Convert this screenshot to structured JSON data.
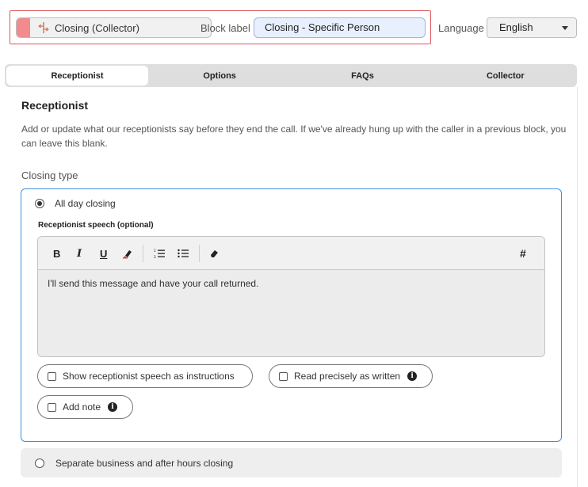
{
  "header": {
    "block_name": "Closing (Collector)",
    "block_color": "#f28b8e",
    "block_icon": "closing-icon",
    "block_label_caption": "Block label",
    "block_label_value": "Closing - Specific Person",
    "language_caption": "Language",
    "language_value": "English"
  },
  "tabs": [
    {
      "label": "Receptionist",
      "active": true
    },
    {
      "label": "Options",
      "active": false
    },
    {
      "label": "FAQs",
      "active": false
    },
    {
      "label": "Collector",
      "active": false
    }
  ],
  "section": {
    "title": "Receptionist",
    "description": "Add or update what our receptionists say before they end the call. If we've already hung up with the caller in a previous block, you can leave this blank.",
    "closing_type_label": "Closing type",
    "options": [
      {
        "label": "All day closing",
        "selected": true
      },
      {
        "label": "Separate business and after hours closing",
        "selected": false
      }
    ],
    "speech_label": "Receptionist speech (optional)",
    "speech_text": "I'll send this message and have your call returned.",
    "toolbar": {
      "bold": "B",
      "italic": "I",
      "underline": "U",
      "variable": "#"
    },
    "checkboxes": [
      {
        "label": "Show receptionist speech as instructions",
        "checked": false
      },
      {
        "label": "Read precisely as written",
        "checked": false,
        "info": true
      },
      {
        "label": "Add note",
        "checked": false,
        "info": true
      }
    ],
    "info_glyph": "i"
  },
  "colors": {
    "accent_border": "#3d8fe0",
    "highlight_frame": "#e0585c",
    "input_bg": "#e8f0fe"
  }
}
